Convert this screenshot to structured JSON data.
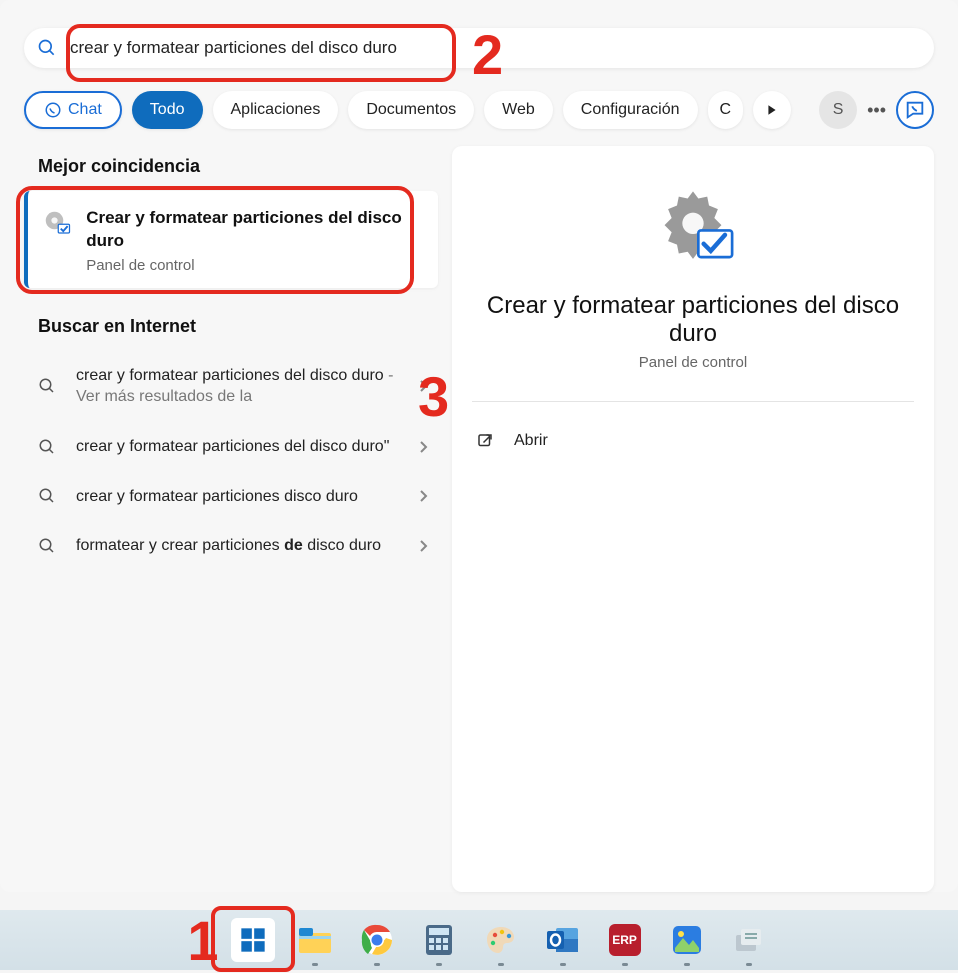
{
  "search": {
    "value": "crear y formatear particiones del disco duro"
  },
  "filters": {
    "chat": "Chat",
    "todo": "Todo",
    "apps": "Aplicaciones",
    "docs": "Documentos",
    "web": "Web",
    "config": "Configuración",
    "more_letter": "C",
    "user_initial": "S",
    "ellipsis": "•••"
  },
  "left": {
    "best_match_header": "Mejor coincidencia",
    "best_match": {
      "title": "Crear y formatear particiones del disco duro",
      "subtitle": "Panel de control"
    },
    "internet_header": "Buscar en Internet",
    "items": [
      {
        "text": "crear y formatear particiones del disco duro",
        "suffix": " - Ver más resultados de la"
      },
      {
        "text": "crear y formatear particiones del disco duro\"",
        "suffix": ""
      },
      {
        "text": "crear y formatear particiones disco duro",
        "suffix": ""
      },
      {
        "text_html": "formatear y crear particiones <b>de</b> disco duro"
      }
    ]
  },
  "right": {
    "title": "Crear y formatear particiones del disco duro",
    "subtitle": "Panel de control",
    "open": "Abrir"
  },
  "annotations": {
    "one": "1",
    "two": "2",
    "three": "3"
  },
  "taskbar": {
    "items": [
      "start",
      "explorer",
      "chrome",
      "calculator",
      "paint",
      "outlook",
      "erp",
      "photos",
      "other"
    ]
  }
}
